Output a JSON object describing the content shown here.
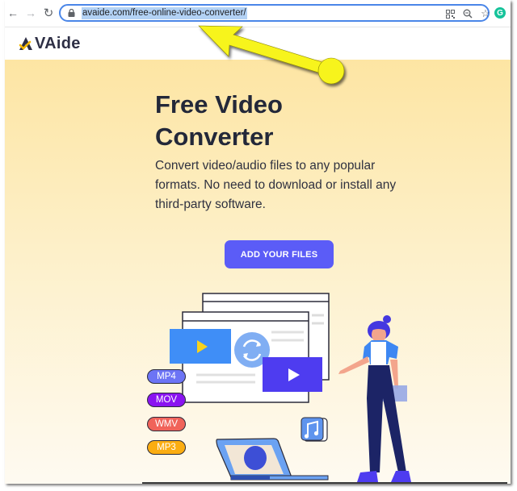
{
  "browser": {
    "url": "avaide.com/free-online-video-converter/",
    "icons": {
      "back": "back-arrow-icon",
      "forward": "forward-arrow-icon",
      "reload": "reload-icon",
      "lock": "lock-icon",
      "qr": "qr-code-icon",
      "zoom": "zoom-icon",
      "bookmark": "star-icon",
      "extension": "grammarly-icon"
    },
    "extension_letter": "G"
  },
  "site": {
    "logo_text": "VAide",
    "logo_mark": "A"
  },
  "hero": {
    "title_line1": "Free Video",
    "title_line2": "Converter",
    "description": "Convert video/audio files to any popular formats. No need to download or install any third-party software.",
    "cta_label": "ADD YOUR FILES"
  },
  "illustration": {
    "formats": [
      {
        "label": "MP4",
        "color": "#6c74f5"
      },
      {
        "label": "MOV",
        "color": "#8a14f0"
      },
      {
        "label": "WMV",
        "color": "#f0635a"
      },
      {
        "label": "MP3",
        "color": "#fbad12"
      }
    ],
    "icons": [
      "play-icon",
      "convert-icon",
      "music-note-icon",
      "laptop-icon",
      "person-icon"
    ]
  },
  "colors": {
    "accent": "#5b5cf7",
    "title": "#232839",
    "hero_top": "#fde5a3",
    "hero_bottom": "#fefaf1",
    "annotation": "#f5f01c"
  }
}
